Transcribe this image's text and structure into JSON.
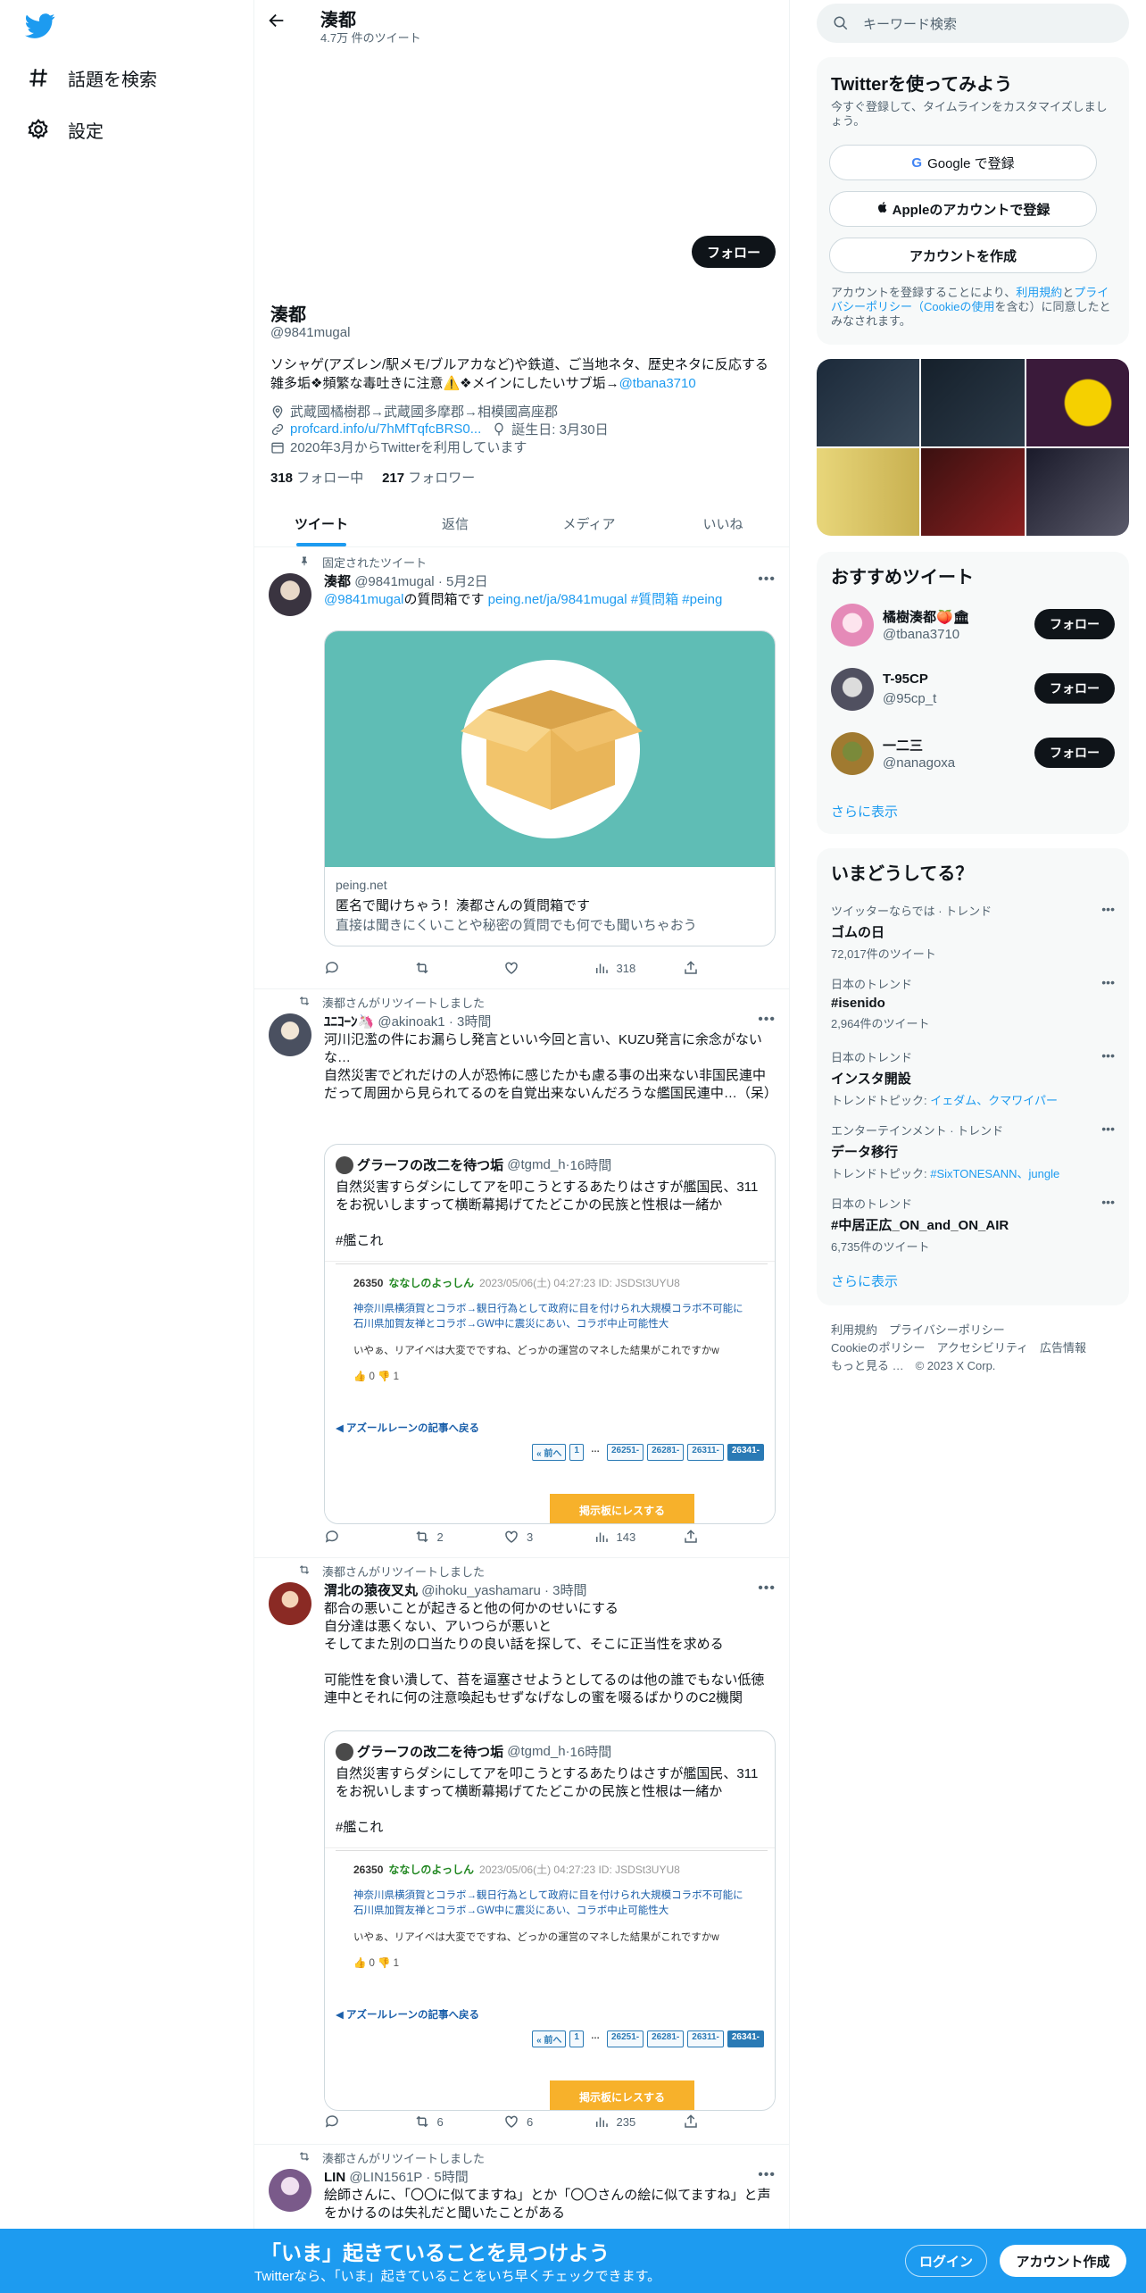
{
  "nav": {
    "explore": "話題を検索",
    "settings": "設定"
  },
  "header": {
    "name": "湊都",
    "tweet_count": "4.7万 件のツイート"
  },
  "profile": {
    "follow_button": "フォロー",
    "name": "湊都",
    "handle": "@9841mugal",
    "bio_text": "ソシャゲ(アズレン/駅メモ/ブルアカなど)や鉄道、ご当地ネタ、歴史ネタに反応する雑多垢❖頻繁な毒吐きに注意⚠️❖メインにしたいサブ垢→",
    "bio_link": "@tbana3710",
    "location": "武蔵國橘樹郡→武蔵國多摩郡→相模國高座郡",
    "url": "profcard.info/u/7hMfTqfcBRS0...",
    "birthday": "誕生日: 3月30日",
    "joined": "2020年3月からTwitterを利用しています",
    "following_count": "318",
    "following_label": "フォロー中",
    "followers_count": "217",
    "followers_label": "フォロワー"
  },
  "tabs": [
    "ツイート",
    "返信",
    "メディア",
    "いいね"
  ],
  "tweets": [
    {
      "context": "固定されたツイート",
      "name": "湊都",
      "handle": "@9841mugal",
      "time": "5月2日",
      "text_mention": "@9841mugal",
      "text_body": "の質問箱です",
      "text_link": "peing.net/ja/9841mugal",
      "text_tags": "#質問箱 #peing",
      "card_domain": "peing.net",
      "card_title": "匿名で聞けちゃう！湊都さんの質問箱です",
      "card_desc": "直接は聞きにくいことや秘密の質問でも何でも聞いちゃおう",
      "views": "318"
    },
    {
      "context": "湊都さんがリツイートしました",
      "name": "ﾕﾆｺｰﾝ🦄",
      "handle": "@akinoak1",
      "time": "3時間",
      "text": "河川氾濫の件にお漏らし発言といい今回と言い、KUZU発言に余念がないな…\n自然災害でどれだけの人が恐怖に感じたかも慮る事の出来ない非国民連中だって周囲から見られてるのを自覚出来ないんだろうな艦国民連中…（呆）",
      "quote_name": "グラーフの改二を待つ垢",
      "quote_handle": "@tgmd_h",
      "quote_time": "16時間",
      "quote_text": "自然災害すらダシにしてアを叩こうとするあたりはさすが艦国民、311をお祝いしますって横断幕掲げてたどこかの民族と性根は一緒か\n\n#艦これ",
      "retweets": "2",
      "likes": "3",
      "views": "143"
    },
    {
      "context": "湊都さんがリツイートしました",
      "name": "渭北の猿夜叉丸",
      "handle": "@ihoku_yashamaru",
      "time": "3時間",
      "text": "都合の悪いことが起きると他の何かのせいにする\n自分達は悪くない、アいつらが悪いと\nそしてまた別の口当たりの良い話を探して、そこに正当性を求める\n\n可能性を食い潰して、苔を逼塞させようとしてるのは他の誰でもない低徳連中とそれに何の注意喚起もせずなげなしの蜜を啜るばかりのC2機関",
      "quote_name": "グラーフの改二を待つ垢",
      "quote_handle": "@tgmd_h",
      "quote_time": "16時間",
      "quote_text": "自然災害すらダシにしてアを叩こうとするあたりはさすが艦国民、311をお祝いしますって横断幕掲げてたどこかの民族と性根は一緒か\n\n#艦これ",
      "retweets": "6",
      "likes": "6",
      "views": "235"
    },
    {
      "context": "湊都さんがリツイートしました",
      "name": "LIN",
      "handle": "@LIN1561P",
      "time": "5時間",
      "text": "絵師さんに、「〇〇に似てますね」とか「〇〇さんの絵に似てますね」と声をかけるのは失礼だと聞いたことがある"
    }
  ],
  "bbs": {
    "num": "26350",
    "name": "ななしのよっしん",
    "date": "2023/05/06(土) 04:27:23 ID: JSDSt3UYU8",
    "line1": "神奈川県横須賀とコラボ→観日行為として政府に目を付けられ大規模コラボ不可能に",
    "line2": "石川県加賀友禅とコラボ→GW中に震災にあい、コラボ中止可能性大",
    "line3": "いやぁ、リアイベは大変でですね、どっかの運営のマネした結果がこれですかw",
    "good": "0",
    "bad": "1",
    "back": "◀ アズールレーンの記事へ戻る",
    "pages": [
      "« 前へ",
      "1",
      "…",
      "26251-",
      "26281-",
      "26311-",
      "26341-"
    ],
    "orange": "掲示板にレスする"
  },
  "sidebar": {
    "search_placeholder": "キーワード検索",
    "signup": {
      "title": "Twitterを使ってみよう",
      "desc": "今すぐ登録して、タイムラインをカスタマイズしましょう。",
      "google": "Google で登録",
      "apple": "Appleのアカウントで登録",
      "create": "アカウントを作成",
      "terms_1": "アカウントを登録することにより、",
      "terms_link1": "利用規約",
      "terms_2": "と",
      "terms_link2": "プライバシーポリシー（Cookieの使用",
      "terms_3": "を含む）に同意したとみなされます。"
    },
    "rec_title": "おすすめツイート",
    "recs": [
      {
        "name": "橘樹湊都🍑🏛",
        "handle": "@tbana3710",
        "follow": "フォロー"
      },
      {
        "name": "T-95CP",
        "handle": "@95cp_t",
        "follow": "フォロー"
      },
      {
        "name": "一二三",
        "handle": "@nanagoxa",
        "follow": "フォロー"
      }
    ],
    "show_more": "さらに表示",
    "trends_title": "いまどうしてる？",
    "trends": [
      {
        "cat": "ツイッターならでは · トレンド",
        "title": "ゴムの日",
        "count": "72,017件のツイート"
      },
      {
        "cat": "日本のトレンド",
        "title": "#isenido",
        "count": "2,964件のツイート"
      },
      {
        "cat": "日本のトレンド",
        "title": "インスタ開設",
        "topic_label": "トレンドトピック: ",
        "topic": "イェダム、クマワイパー"
      },
      {
        "cat": "エンターテインメント · トレンド",
        "title": "データ移行",
        "topic_label": "トレンドトピック: ",
        "topic": "#SixTONESANN、jungle"
      },
      {
        "cat": "日本のトレンド",
        "title": "#中居正広_ON_and_ON_AIR",
        "count": "6,735件のツイート"
      }
    ],
    "trends_more": "さらに表示",
    "footer_1": "利用規約　プライバシーポリシー",
    "footer_2": "Cookieのポリシー　アクセシビリティ　広告情報",
    "footer_3": "もっと見る …　© 2023 X Corp."
  },
  "bottom_bar": {
    "title": "「いま」起きていることを見つけよう",
    "subtitle": "Twitterなら、「いま」起きていることをいち早くチェックできます。",
    "login": "ログイン",
    "create": "アカウント作成"
  },
  "colors": {
    "accent": "#1d9bf0",
    "peing_bg": "#5fbdb5",
    "box_color": "#f2c46b"
  }
}
